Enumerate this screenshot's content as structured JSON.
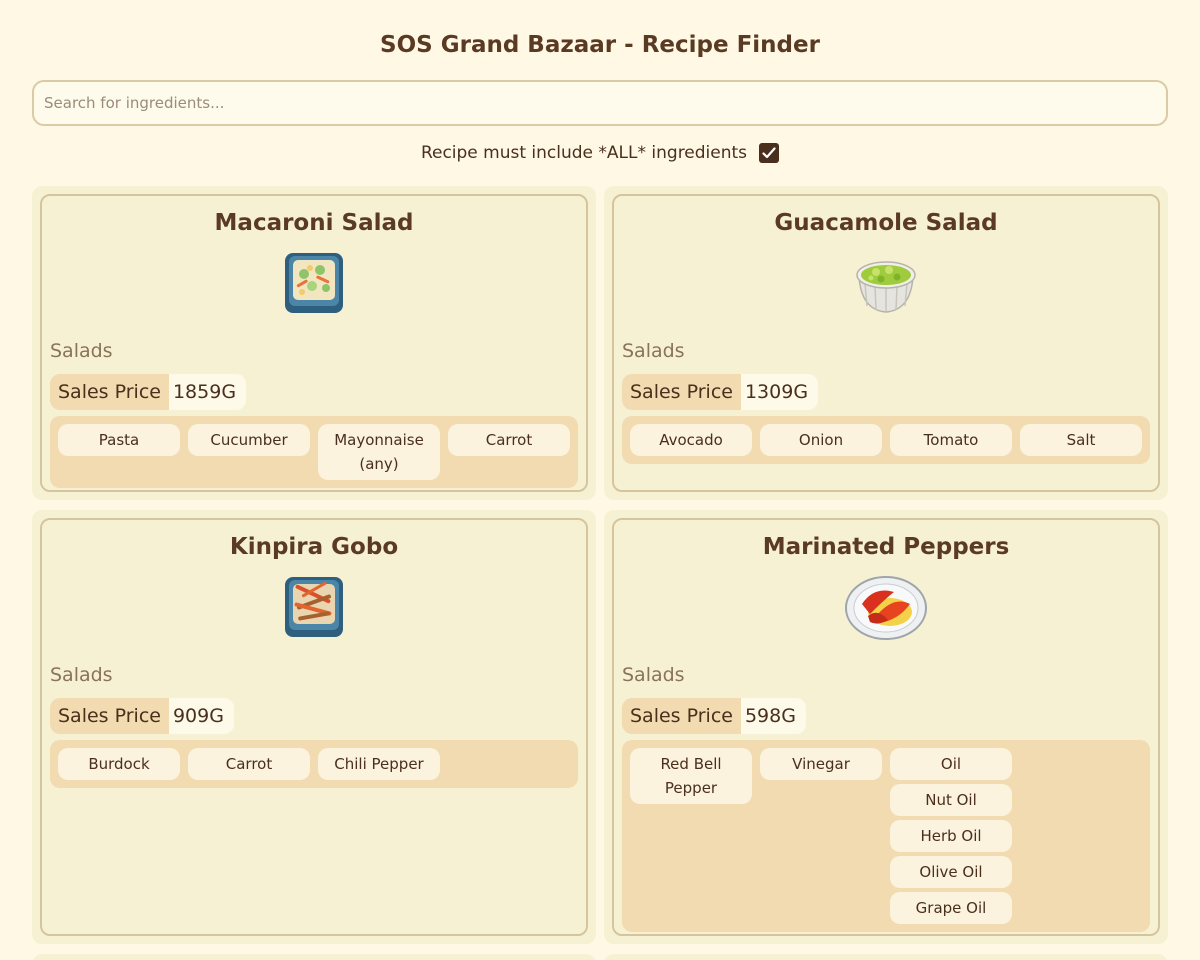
{
  "header": {
    "title": "SOS Grand Bazaar - Recipe Finder"
  },
  "search": {
    "placeholder": "Search for ingredients...",
    "value": ""
  },
  "filter": {
    "label": "Recipe must include *ALL* ingredients",
    "checked": true
  },
  "recipes": [
    {
      "name": "Macaroni Salad",
      "category": "Salads",
      "price_label": "Sales Price",
      "price": "1859G",
      "icon": "macaroni-salad-dish-icon",
      "ingredients": [
        [
          "Pasta"
        ],
        [
          "Cucumber"
        ],
        [
          "Mayonnaise (any)"
        ],
        [
          "Carrot"
        ]
      ]
    },
    {
      "name": "Guacamole Salad",
      "category": "Salads",
      "price_label": "Sales Price",
      "price": "1309G",
      "icon": "guacamole-salad-dish-icon",
      "ingredients": [
        [
          "Avocado"
        ],
        [
          "Onion"
        ],
        [
          "Tomato"
        ],
        [
          "Salt"
        ]
      ]
    },
    {
      "name": "Kinpira Gobo",
      "category": "Salads",
      "price_label": "Sales Price",
      "price": "909G",
      "icon": "kinpira-gobo-dish-icon",
      "ingredients": [
        [
          "Burdock"
        ],
        [
          "Carrot"
        ],
        [
          "Chili Pepper"
        ]
      ]
    },
    {
      "name": "Marinated Peppers",
      "category": "Salads",
      "price_label": "Sales Price",
      "price": "598G",
      "icon": "marinated-peppers-dish-icon",
      "ingredients": [
        [
          "Red Bell Pepper"
        ],
        [
          "Vinegar"
        ],
        [
          "Oil",
          "Nut Oil",
          "Herb Oil",
          "Olive Oil",
          "Grape Oil"
        ]
      ]
    }
  ],
  "colors": {
    "background": "#fef8e5",
    "card": "#f7f1d4",
    "accent": "#f2dbb0",
    "text": "#4a2f1d"
  }
}
